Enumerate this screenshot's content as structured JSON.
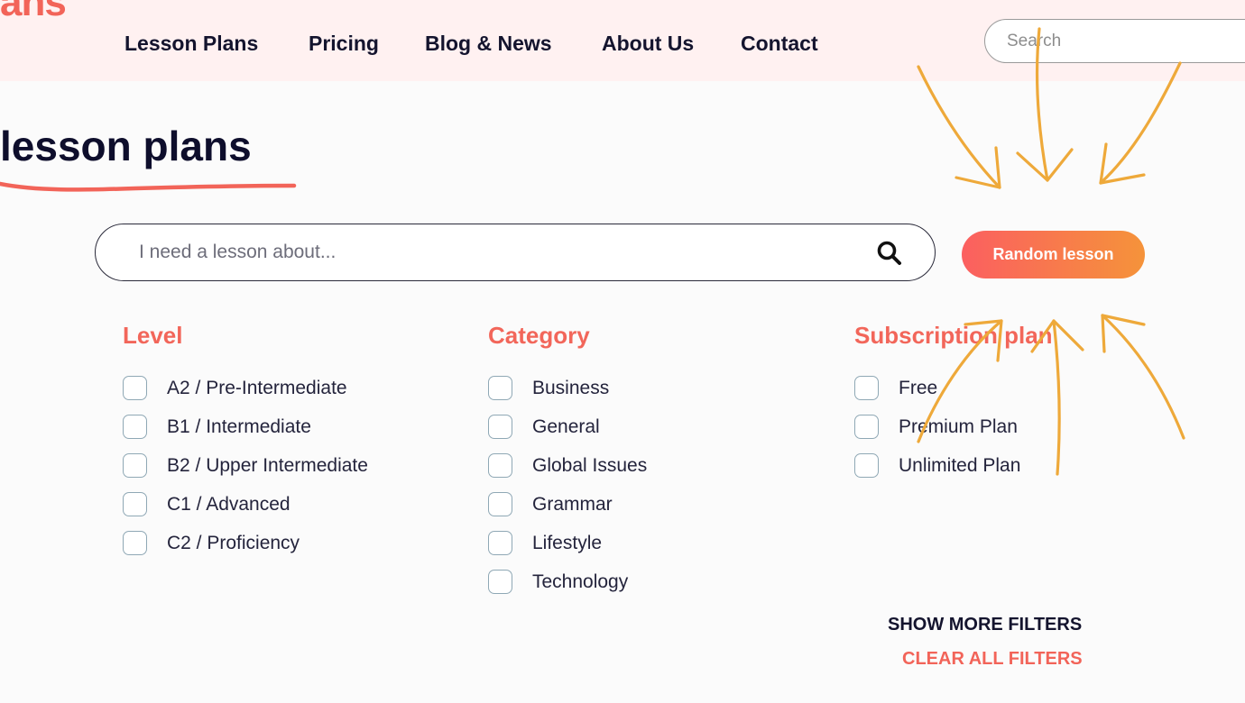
{
  "header": {
    "logo_text": "ans",
    "nav": [
      {
        "label": "Lesson Plans"
      },
      {
        "label": "Pricing"
      },
      {
        "label": "Blog & News"
      },
      {
        "label": "About Us"
      },
      {
        "label": "Contact"
      }
    ],
    "search": {
      "placeholder": "Search",
      "value": ""
    }
  },
  "main": {
    "title": "lesson plans",
    "search": {
      "placeholder": "I need a lesson about...",
      "value": ""
    },
    "random_button": "Random lesson"
  },
  "filters": {
    "level": {
      "heading": "Level",
      "options": [
        "A2 / Pre-Intermediate",
        "B1 / Intermediate",
        "B2 / Upper Intermediate",
        "C1 / Advanced",
        "C2 / Proficiency"
      ]
    },
    "category": {
      "heading": "Category",
      "options": [
        "Business",
        "General",
        "Global Issues",
        "Grammar",
        "Lifestyle",
        "Technology"
      ]
    },
    "subscription": {
      "heading": "Subscription plan",
      "options": [
        "Free",
        "Premium Plan",
        "Unlimited Plan"
      ]
    },
    "show_more": "SHOW MORE FILTERS",
    "clear_all": "CLEAR ALL FILTERS"
  },
  "colors": {
    "accent": "#f26459",
    "header_bg": "#fff1f1",
    "annotation_arrows": "#eea93a",
    "button_gradient_start": "#fb5f60",
    "button_gradient_end": "#f5933a"
  }
}
